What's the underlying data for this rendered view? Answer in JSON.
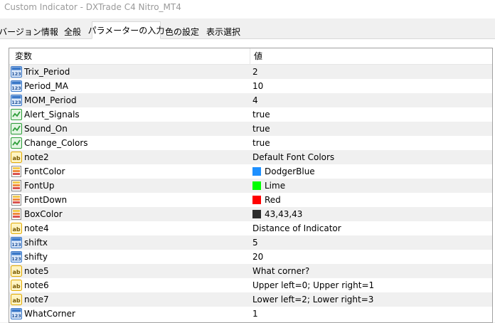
{
  "window": {
    "title": "Custom Indicator - DXTrade C4 Nitro_MT4"
  },
  "tabs": [
    {
      "label": "バージョン情報",
      "active": false
    },
    {
      "label": "全般",
      "active": false
    },
    {
      "label": "パラメーターの入力",
      "active": true
    },
    {
      "label": "色の設定",
      "active": false
    },
    {
      "label": "表示選択",
      "active": false
    }
  ],
  "grid": {
    "columns": {
      "variable": "変数",
      "value": "値"
    },
    "rows": [
      {
        "name": "Trix_Period",
        "value": "2",
        "icon": "integer-icon"
      },
      {
        "name": "Period_MA",
        "value": "10",
        "icon": "integer-icon"
      },
      {
        "name": "MOM_Period",
        "value": "4",
        "icon": "integer-icon"
      },
      {
        "name": "Alert_Signals",
        "value": "true",
        "icon": "boolean-icon"
      },
      {
        "name": "Sound_On",
        "value": "true",
        "icon": "boolean-icon"
      },
      {
        "name": "Change_Colors",
        "value": "true",
        "icon": "boolean-icon"
      },
      {
        "name": "note2",
        "value": "Default Font Colors",
        "icon": "string-icon"
      },
      {
        "name": "FontColor",
        "value": "DodgerBlue",
        "icon": "color-icon",
        "swatch": "#1e90ff"
      },
      {
        "name": "FontUp",
        "value": "Lime",
        "icon": "color-icon",
        "swatch": "#00ff00"
      },
      {
        "name": "FontDown",
        "value": "Red",
        "icon": "color-icon",
        "swatch": "#ff0000"
      },
      {
        "name": "BoxColor",
        "value": "43,43,43",
        "icon": "color-icon",
        "swatch": "#2b2b2b"
      },
      {
        "name": "note4",
        "value": "Distance of Indicator",
        "icon": "string-icon"
      },
      {
        "name": "shiftx",
        "value": "5",
        "icon": "integer-icon"
      },
      {
        "name": "shifty",
        "value": "20",
        "icon": "integer-icon"
      },
      {
        "name": "note5",
        "value": "What corner?",
        "icon": "string-icon"
      },
      {
        "name": "note6",
        "value": "Upper left=0; Upper right=1",
        "icon": "string-icon"
      },
      {
        "name": "note7",
        "value": "Lower left=2; Lower right=3",
        "icon": "string-icon"
      },
      {
        "name": "WhatCorner",
        "value": "1",
        "icon": "integer-icon"
      }
    ]
  },
  "colors": {
    "row_alt": "#f0f0f0",
    "int_icon": "#3a78c8",
    "bool_icon": "#2e9e3a",
    "string_icon": "#e0a800"
  }
}
